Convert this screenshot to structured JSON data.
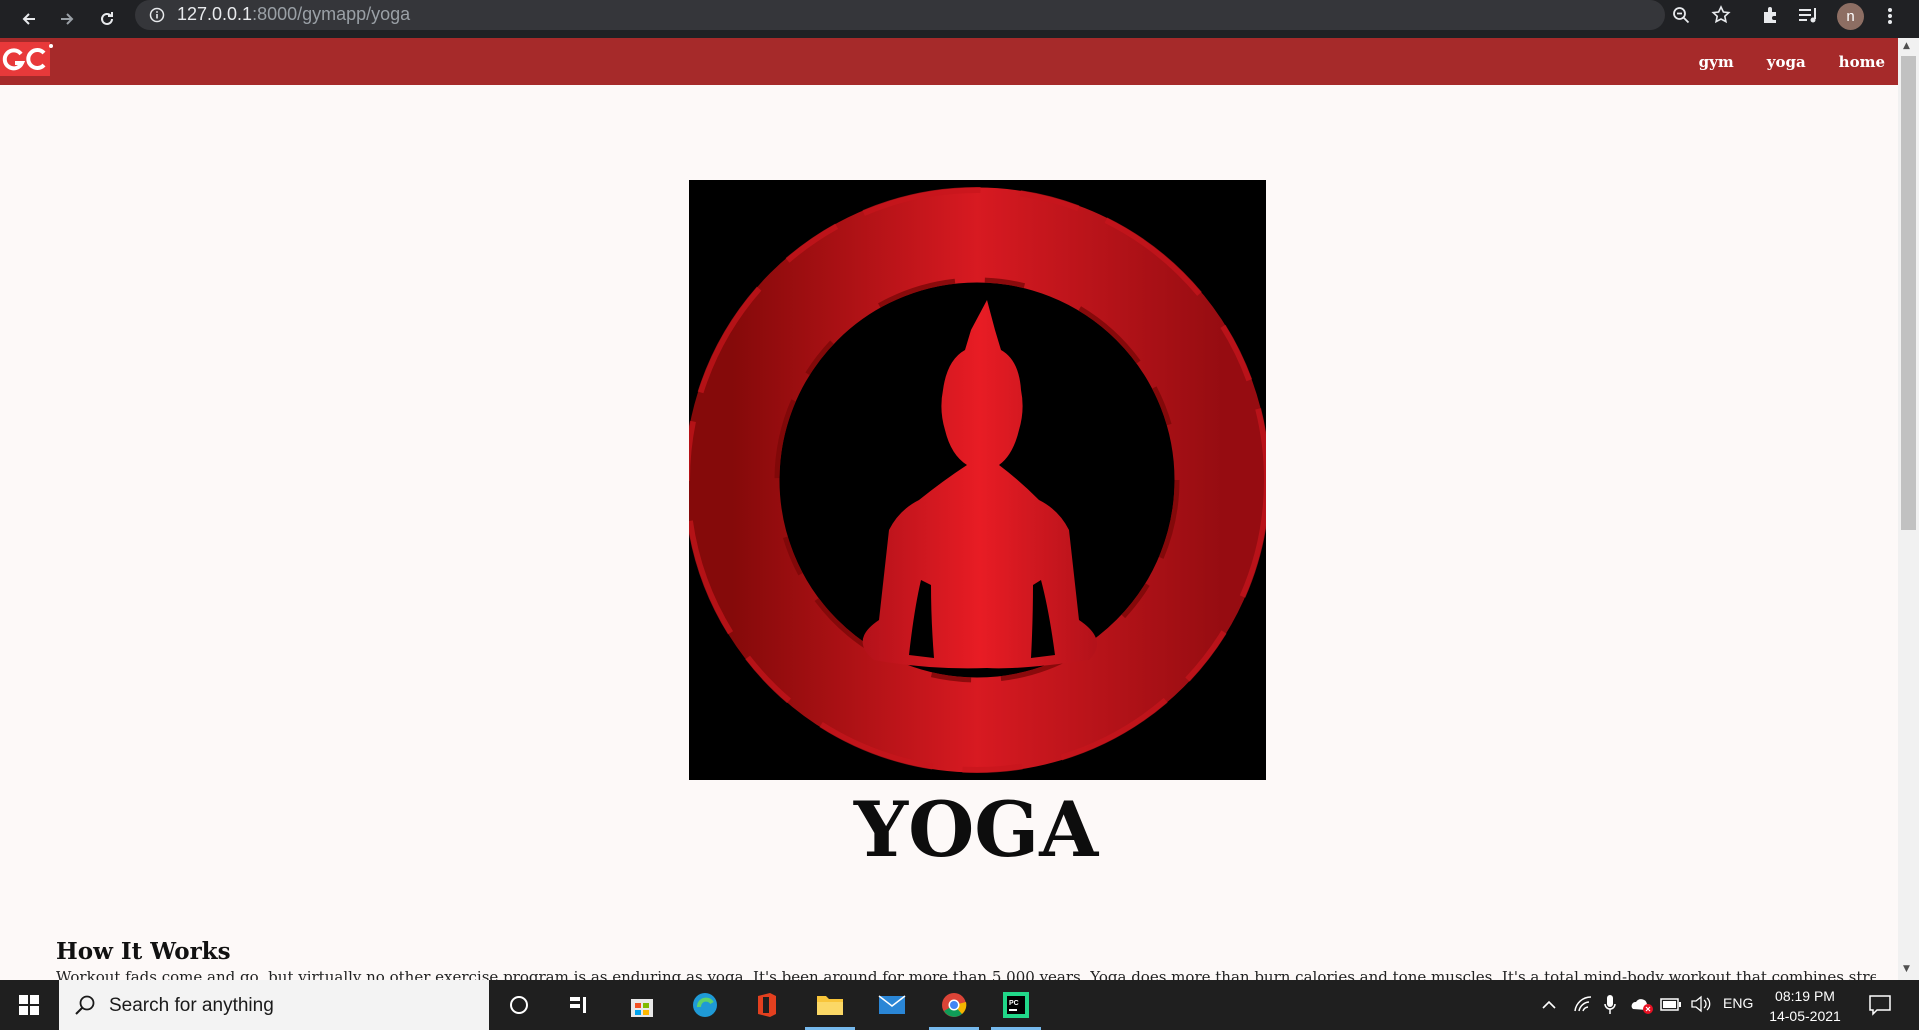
{
  "browser": {
    "url_host": "127.0.0.1",
    "url_path": ":8000/gymapp/yoga",
    "profile_initial": "n",
    "icons": [
      "back-icon",
      "forward-icon",
      "reload-icon",
      "site-info-icon",
      "zoom-icon",
      "bookmark-star-icon",
      "extensions-icon",
      "media-queue-icon",
      "menu-icon"
    ]
  },
  "navbar": {
    "logo_text": "GC",
    "links": [
      "gym",
      "yoga",
      "home"
    ],
    "background": "#a62a2a"
  },
  "main": {
    "heading": "YOGA",
    "section_title": "How It Works",
    "section_text": "Workout fads come and go, but virtually no other exercise program is as enduring as yoga. It's been around for more than 5,000 years. Yoga does more than burn calories and tone muscles. It's a total mind-body workout that combines strengthening and stretching"
  },
  "taskbar": {
    "search_placeholder": "Search for anything",
    "language": "ENG",
    "time": "08:19 PM",
    "date": "14-05-2021"
  },
  "colors": {
    "accent_red": "#e31b23",
    "dark_red": "#8c0a0a"
  }
}
